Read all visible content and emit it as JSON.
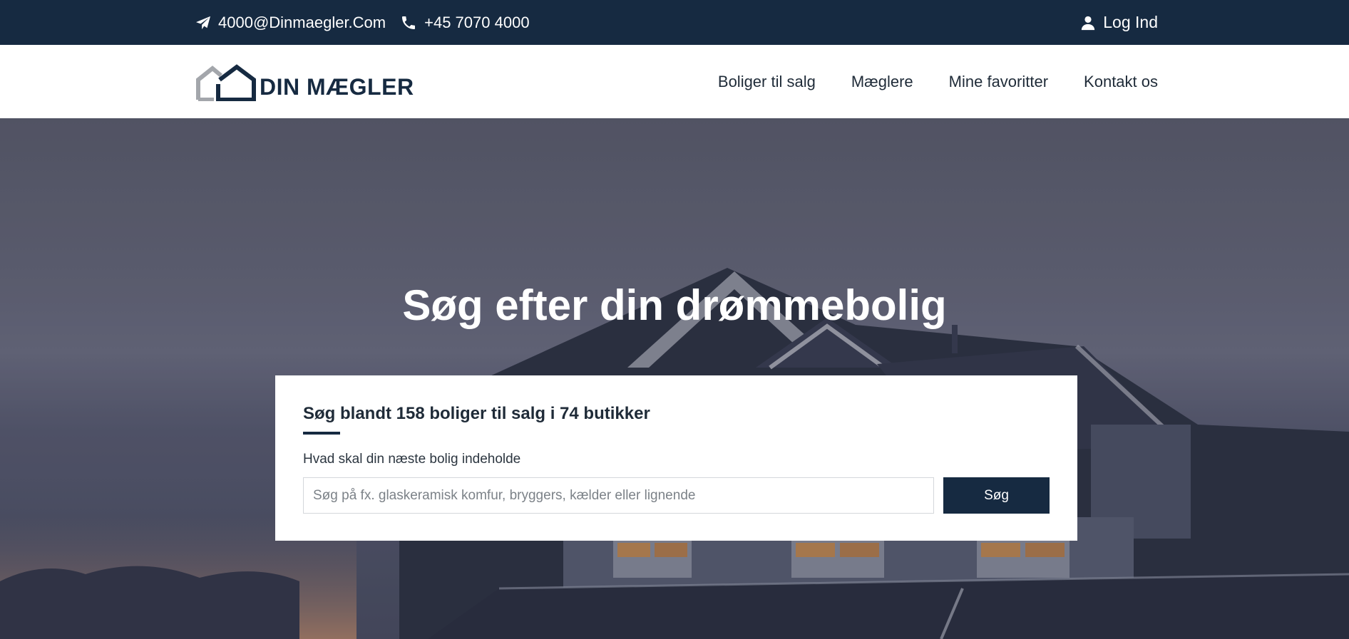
{
  "topbar": {
    "email": "4000@Dinmaegler.Com",
    "phone": "+45 7070 4000",
    "login_label": "Log Ind"
  },
  "header": {
    "logo_text": "DIN MÆGLER",
    "nav": [
      {
        "label": "Boliger til salg"
      },
      {
        "label": "Mæglere"
      },
      {
        "label": "Mine favoritter"
      },
      {
        "label": "Kontakt os"
      }
    ]
  },
  "hero": {
    "title": "Søg efter din drømmebolig"
  },
  "search": {
    "heading": "Søg blandt 158 boliger til salg i 74 butikker",
    "label": "Hvad skal din næste bolig indeholde",
    "placeholder": "Søg på fx. glaskeramisk komfur, bryggers, kælder eller lignende",
    "value": "",
    "button_label": "Søg"
  },
  "colors": {
    "primary": "#162a41",
    "white": "#ffffff"
  }
}
